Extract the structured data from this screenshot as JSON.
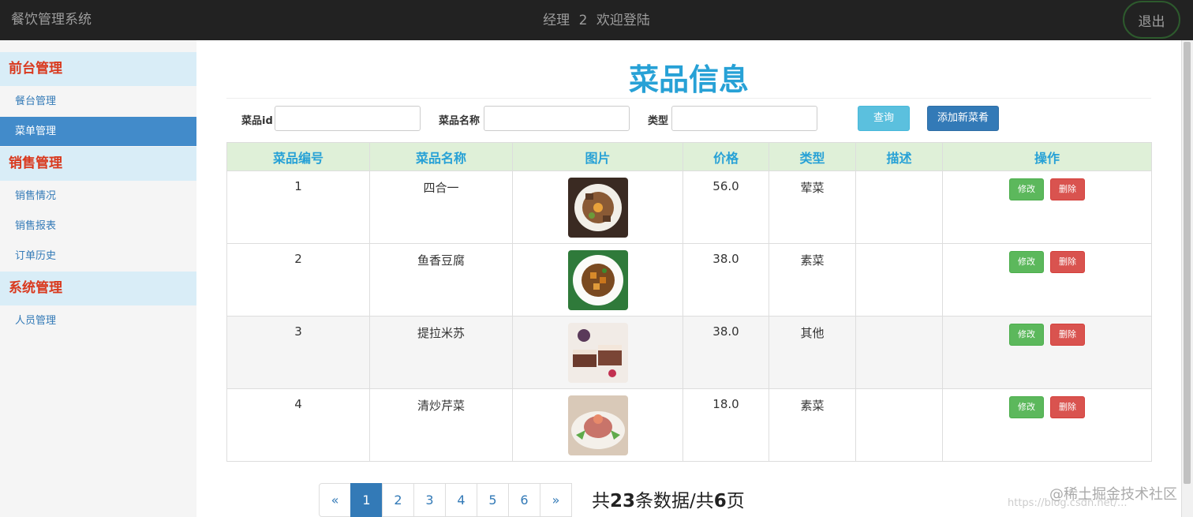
{
  "header": {
    "app_title": "餐饮管理系统",
    "welcome_role": "经理",
    "welcome_id": "2",
    "welcome_text": "欢迎登陆",
    "logout_label": "退出"
  },
  "sidebar": {
    "groups": [
      {
        "label": "前台管理",
        "items": [
          "餐台管理",
          "菜单管理"
        ]
      },
      {
        "label": "销售管理",
        "items": [
          "销售情况",
          "销售报表",
          "订单历史"
        ]
      },
      {
        "label": "系统管理",
        "items": [
          "人员管理"
        ]
      }
    ],
    "active_item": "菜单管理"
  },
  "page": {
    "title": "菜品信息"
  },
  "filters": {
    "id_label": "菜品id",
    "name_label": "菜品名称",
    "type_label": "类型",
    "id_value": "",
    "name_value": "",
    "type_value": "",
    "query_button": "查询",
    "add_button": "添加新菜肴"
  },
  "table": {
    "headers": [
      "菜品编号",
      "菜品名称",
      "图片",
      "价格",
      "类型",
      "描述",
      "操作"
    ],
    "rows": [
      {
        "id": "1",
        "name": "四合一",
        "image": "dish-photo-meat-platter",
        "price": "56.0",
        "type": "荤菜",
        "desc": ""
      },
      {
        "id": "2",
        "name": "鱼香豆腐",
        "image": "dish-photo-tofu",
        "price": "38.0",
        "type": "素菜",
        "desc": ""
      },
      {
        "id": "3",
        "name": "提拉米苏",
        "image": "dish-photo-tiramisu",
        "price": "38.0",
        "type": "其他",
        "desc": ""
      },
      {
        "id": "4",
        "name": "清炒芹菜",
        "image": "dish-photo-celery",
        "price": "18.0",
        "type": "素菜",
        "desc": ""
      }
    ],
    "edit_label": "修改",
    "delete_label": "删除"
  },
  "pagination": {
    "prev": "«",
    "pages": [
      "1",
      "2",
      "3",
      "4",
      "5",
      "6"
    ],
    "current": "1",
    "next": "»",
    "summary_prefix": "共",
    "total_records": "23",
    "summary_mid": "条数据/共",
    "total_pages": "6",
    "summary_suffix": "页"
  },
  "watermark": {
    "text": "@稀土掘金技术社区",
    "url_text": "https://blog.csdn.net/..."
  },
  "colors": {
    "accent": "#27a1d6",
    "sidebar_heading": "#d9391e",
    "active": "#428bca"
  }
}
